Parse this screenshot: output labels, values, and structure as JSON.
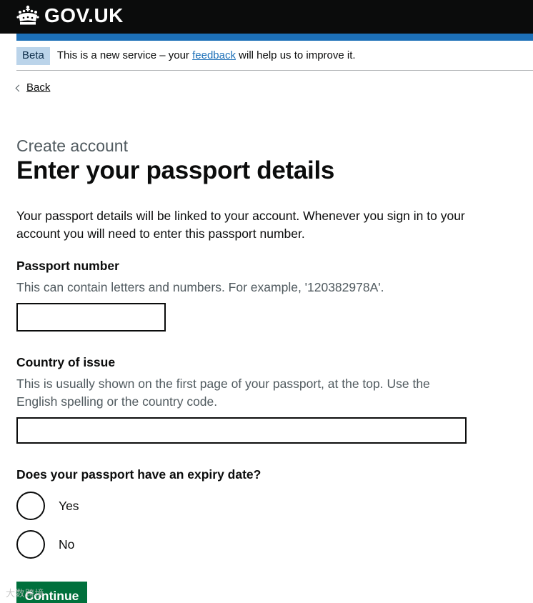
{
  "header": {
    "logo_text": "GOV.UK",
    "crown_icon": "crown-icon",
    "bar_color": "#1d70b8"
  },
  "phase_banner": {
    "tag": "Beta",
    "text_before": "This is a new service – your ",
    "link_text": "feedback",
    "text_after": " will help us to improve it."
  },
  "back_link": {
    "label": "Back",
    "icon": "chevron-left-icon"
  },
  "main": {
    "caption": "Create account",
    "title": "Enter your passport details",
    "lead": "Your passport details will be linked to your account. Whenever you sign in to your account you will need to enter this passport number."
  },
  "passport_number": {
    "label": "Passport number",
    "hint": "This can contain letters and numbers. For example, '120382978A'.",
    "value": ""
  },
  "country_of_issue": {
    "label": "Country of issue",
    "hint": "This is usually shown on the first page of your passport, at the top. Use the English spelling or the country code.",
    "value": ""
  },
  "expiry_question": {
    "legend": "Does your passport have an expiry date?",
    "options": [
      {
        "label": "Yes",
        "checked": false
      },
      {
        "label": "No",
        "checked": false
      }
    ]
  },
  "continue_button": {
    "label": "Continue",
    "color": "#00703c"
  },
  "watermark": {
    "text": "大数跨境"
  }
}
